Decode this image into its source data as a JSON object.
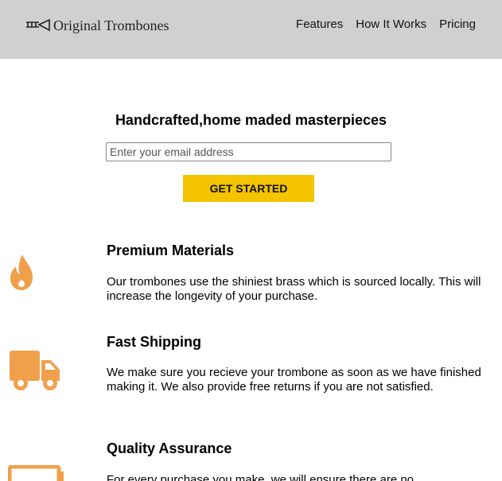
{
  "header": {
    "logo_text": "Original Trombones",
    "logo_icon": "trombone-icon",
    "nav": [
      "Features",
      "How It Works",
      "Pricing"
    ]
  },
  "hero": {
    "title": "Handcrafted,home maded masterpieces",
    "email_placeholder": "Enter your email address",
    "cta_label": "GET STARTED"
  },
  "features": [
    {
      "icon": "fire-icon",
      "title": "Premium Materials",
      "text": "Our trombones use the shiniest brass which is sourced locally. This will increase the longevity of your purchase."
    },
    {
      "icon": "truck-icon",
      "title": "Fast Shipping",
      "text": "We make sure you recieve your trombone as soon as we have finished making it. We also provide free returns if you are not satisfied."
    },
    {
      "icon": "battery-icon",
      "title": "Quality Assurance",
      "text": "For every purchase you make, we will ensure there are no"
    }
  ],
  "colors": {
    "header_bg": "#d0d0d0",
    "cta_bg": "#f5c400",
    "icon_orange": "#f0a04b"
  }
}
